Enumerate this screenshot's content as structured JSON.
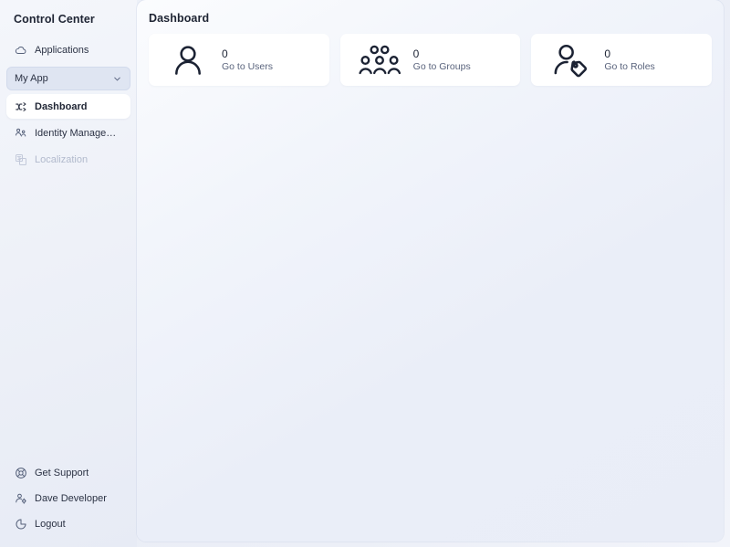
{
  "sidebar": {
    "brand": "Control Center",
    "top_items": [
      {
        "label": "Applications",
        "icon": "cloud-icon",
        "state": "normal"
      },
      {
        "label": "My App",
        "icon": "chevron-down-icon",
        "state": "selector"
      },
      {
        "label": "Dashboard",
        "icon": "dashboard-shuffle-icon",
        "state": "active"
      },
      {
        "label": "Identity Management",
        "icon": "users-network-icon",
        "state": "normal"
      },
      {
        "label": "Localization",
        "icon": "localization-icon",
        "state": "disabled"
      }
    ],
    "bottom_items": [
      {
        "label": "Get Support",
        "icon": "lifebuoy-icon"
      },
      {
        "label": "Dave Developer",
        "icon": "user-gear-icon"
      },
      {
        "label": "Logout",
        "icon": "logout-icon"
      }
    ]
  },
  "main": {
    "title": "Dashboard",
    "cards": [
      {
        "count": "0",
        "link_label": "Go to Users",
        "icon": "user-icon"
      },
      {
        "count": "0",
        "link_label": "Go to Groups",
        "icon": "users-group-icon"
      },
      {
        "count": "0",
        "link_label": "Go to Roles",
        "icon": "user-tag-icon"
      }
    ]
  },
  "colors": {
    "page_background": "#eef1f8",
    "panel_background": "#f2f5fb",
    "card_background": "#ffffff",
    "text_primary": "#1e2433",
    "text_muted": "#59637c",
    "text_disabled": "#b2bacd",
    "selector_background": "#dfe5f2"
  }
}
